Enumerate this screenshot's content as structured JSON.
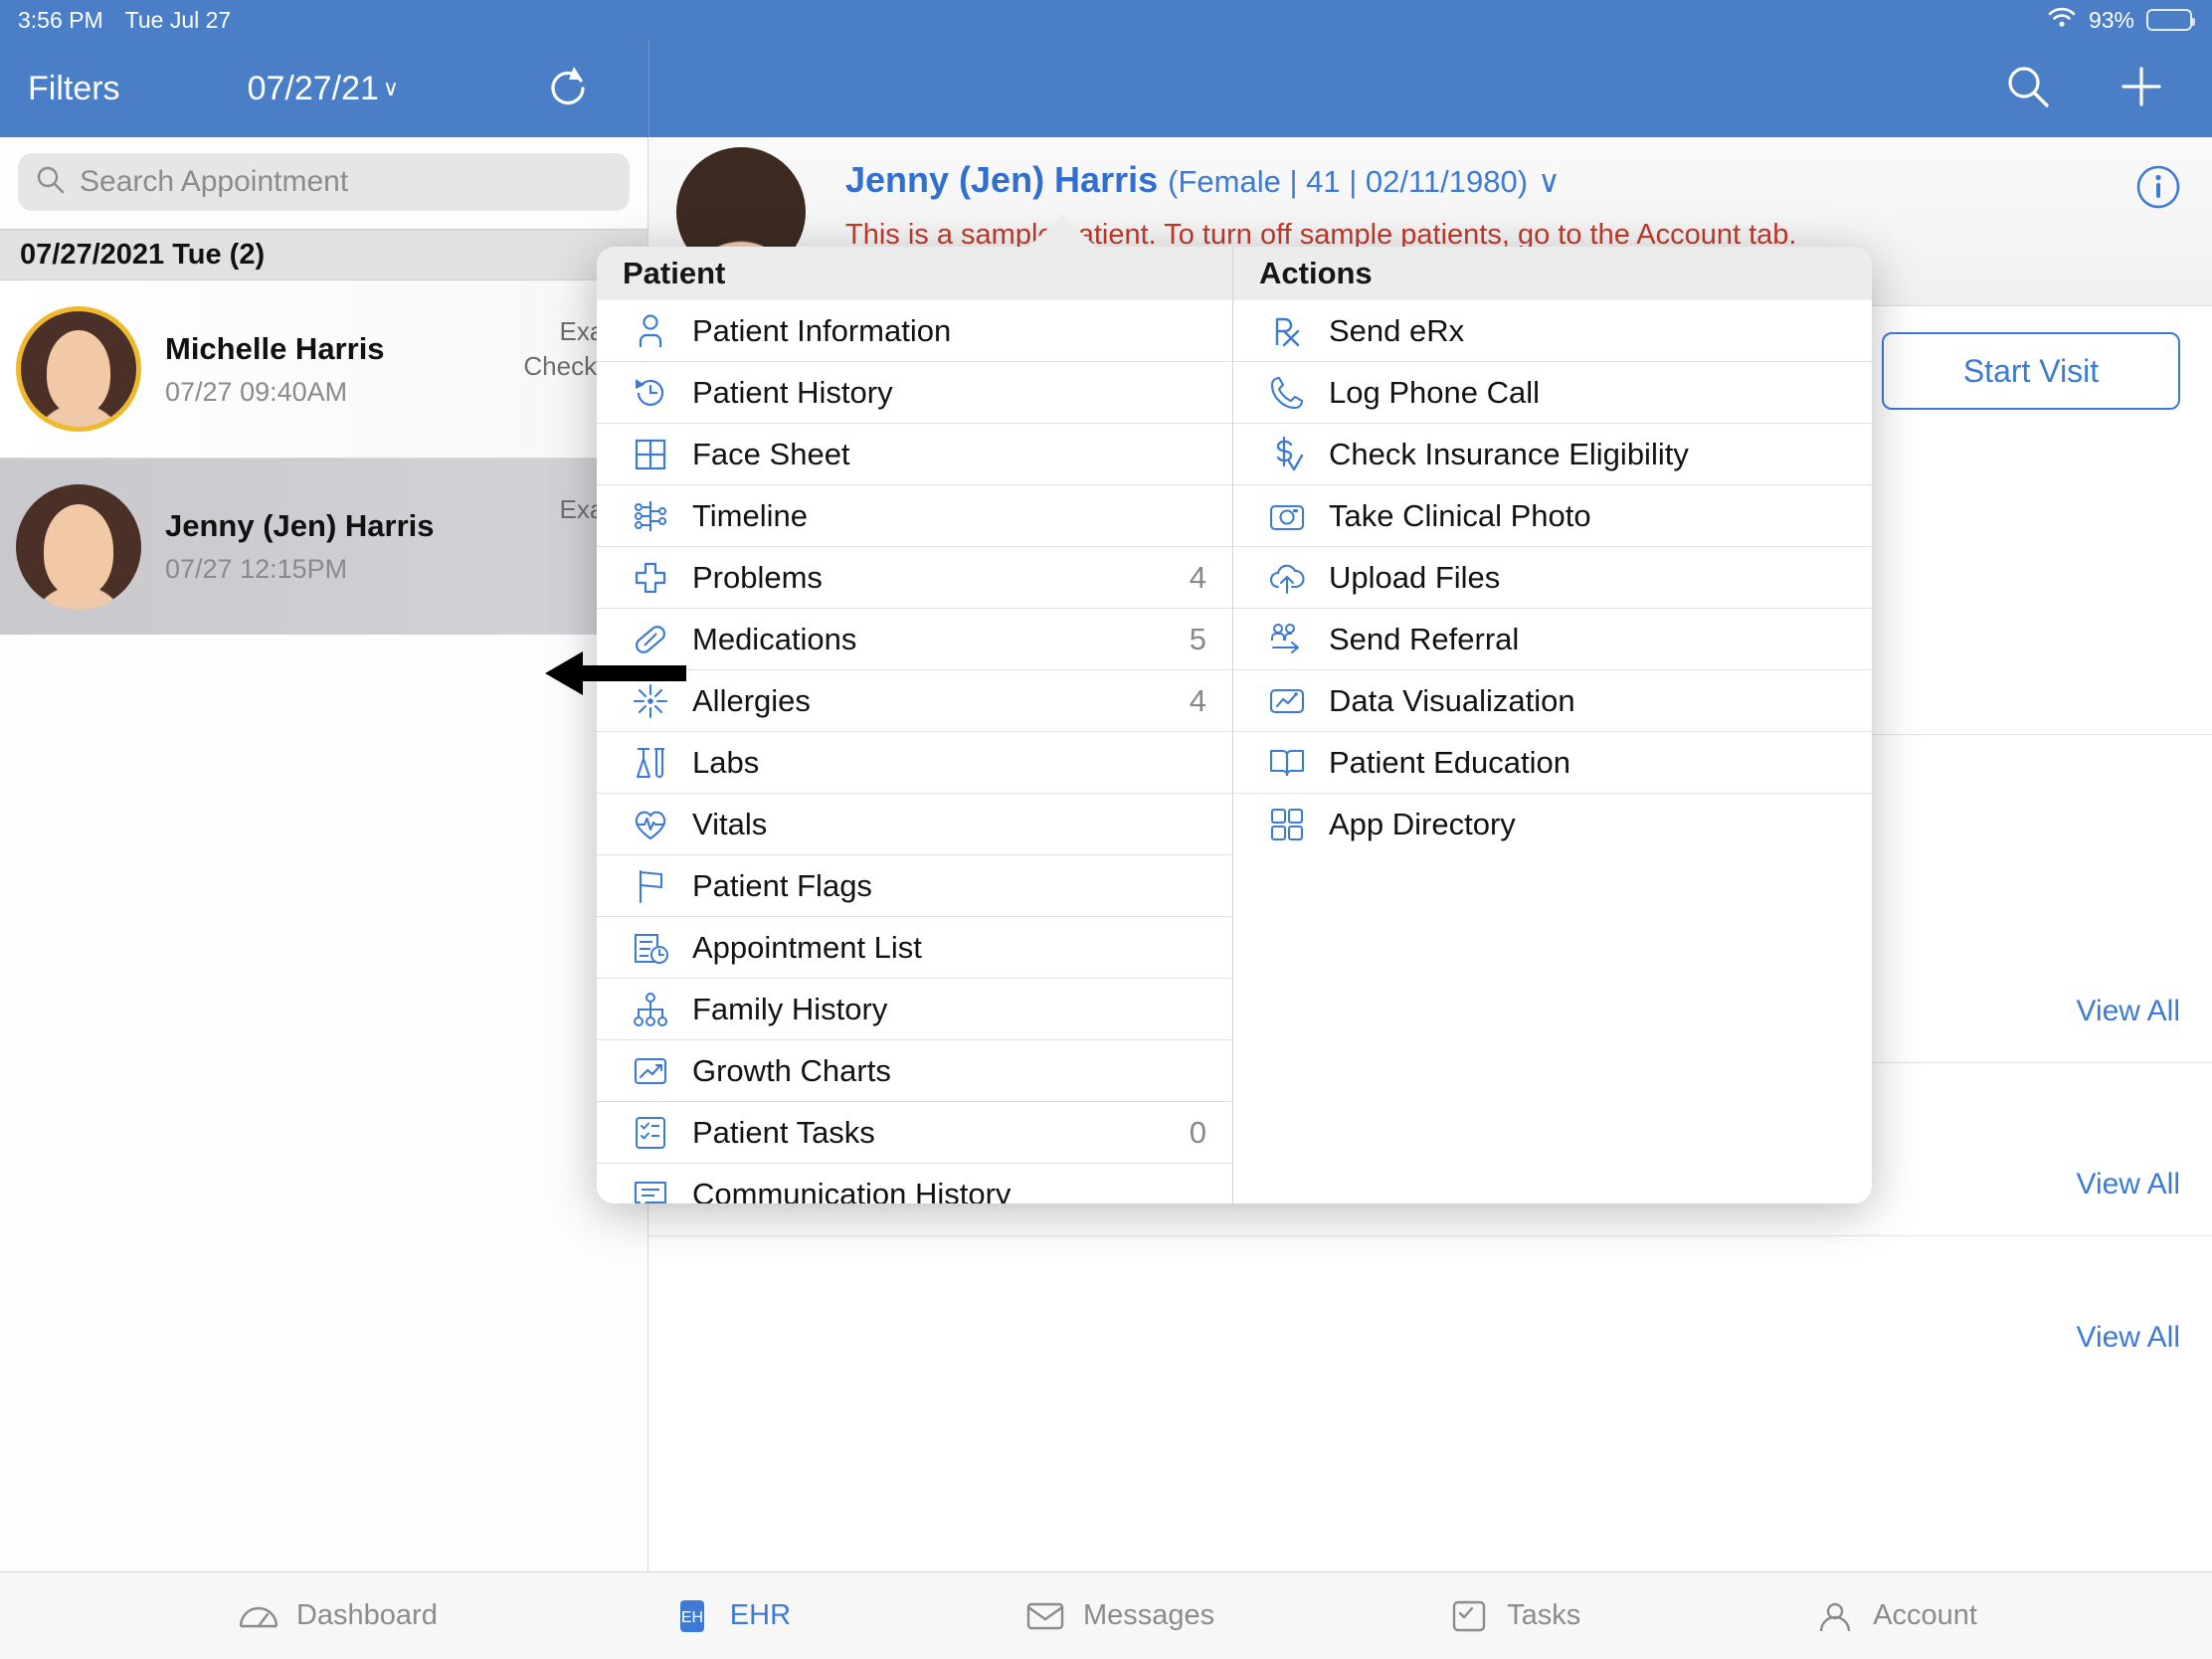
{
  "status_bar": {
    "time": "3:56 PM",
    "date": "Tue Jul 27",
    "battery_percent": "93%",
    "wifi_icon": "wifi-icon",
    "battery_icon": "battery-icon"
  },
  "nav": {
    "filters_label": "Filters",
    "date_label": "07/27/21",
    "date_caret": "∨",
    "refresh_icon": "refresh-icon",
    "search_icon": "search-icon",
    "add_icon": "plus-icon"
  },
  "sidebar": {
    "search_placeholder": "Search Appointment",
    "search_icon": "search-icon",
    "day_group_label": "07/27/2021 Tue (2)",
    "appointments": [
      {
        "name": "Michelle Harris",
        "time": "07/27 09:40AM",
        "status_line1": "Exam",
        "status_line2": "Checked",
        "dot_color": "#e0a92b",
        "selected": false,
        "ring": true
      },
      {
        "name": "Jenny (Jen) Harris",
        "time": "07/27 12:15PM",
        "status_line1": "Exam",
        "status_line2": "",
        "dot_color": "#a9a6e8",
        "selected": true,
        "ring": false
      }
    ]
  },
  "patient_header": {
    "name": "Jenny (Jen) Harris",
    "meta": "(Female | 41 | 02/11/1980)",
    "caret": "∨",
    "warning": "This is a sample patient. To turn off sample patients, go to the Account tab.",
    "info_icon": "info-icon",
    "start_visit_label": "Start Visit",
    "view_all_label": "View All"
  },
  "popover": {
    "patient": {
      "title": "Patient",
      "items": [
        {
          "label": "Patient Information",
          "icon": "person-icon",
          "count": ""
        },
        {
          "label": "Patient History",
          "icon": "clock-rewind-icon",
          "count": ""
        },
        {
          "label": "Face Sheet",
          "icon": "grid-icon",
          "count": ""
        },
        {
          "label": "Timeline",
          "icon": "timeline-icon",
          "count": ""
        },
        {
          "label": "Problems",
          "icon": "medical-cross-icon",
          "count": "4"
        },
        {
          "label": "Medications",
          "icon": "pill-icon",
          "count": "5"
        },
        {
          "label": "Allergies",
          "icon": "allergy-burst-icon",
          "count": "4"
        },
        {
          "label": "Labs",
          "icon": "lab-flask-icon",
          "count": ""
        },
        {
          "label": "Vitals",
          "icon": "heart-pulse-icon",
          "count": ""
        },
        {
          "label": "Patient Flags",
          "icon": "flag-icon",
          "count": ""
        },
        {
          "label": "Appointment List",
          "icon": "appointment-list-icon",
          "count": ""
        },
        {
          "label": "Family History",
          "icon": "family-tree-icon",
          "count": ""
        },
        {
          "label": "Growth Charts",
          "icon": "growth-chart-icon",
          "count": ""
        },
        {
          "label": "Patient Tasks",
          "icon": "checklist-icon",
          "count": "0"
        },
        {
          "label": "Communication History",
          "icon": "chat-lines-icon",
          "count": ""
        }
      ]
    },
    "actions": {
      "title": "Actions",
      "items": [
        {
          "label": "Send eRx",
          "icon": "rx-icon"
        },
        {
          "label": "Log Phone Call",
          "icon": "phone-icon"
        },
        {
          "label": "Check Insurance Eligibility",
          "icon": "dollar-check-icon"
        },
        {
          "label": "Take Clinical Photo",
          "icon": "camera-icon"
        },
        {
          "label": "Upload Files",
          "icon": "cloud-upload-icon"
        },
        {
          "label": "Send Referral",
          "icon": "referral-icon"
        },
        {
          "label": "Data Visualization",
          "icon": "chart-box-icon"
        },
        {
          "label": "Patient Education",
          "icon": "book-icon"
        },
        {
          "label": "App Directory",
          "icon": "app-grid-icon"
        }
      ]
    },
    "annotation": {
      "points_to": "Labs",
      "icon": "black-left-arrow-annotation"
    }
  },
  "tabbar": {
    "items": [
      {
        "label": "Dashboard",
        "icon": "gauge-icon",
        "active": false
      },
      {
        "label": "EHR",
        "icon": "ehr-icon",
        "active": true
      },
      {
        "label": "Messages",
        "icon": "messages-icon",
        "active": false
      },
      {
        "label": "Tasks",
        "icon": "tasks-icon",
        "active": false
      },
      {
        "label": "Account",
        "icon": "account-icon",
        "active": false
      }
    ]
  },
  "colors": {
    "brand_blue": "#4a7fc8",
    "accent_blue": "#3d7ad6",
    "warning_red": "#c0392b",
    "selected_row": "#cccccf"
  }
}
